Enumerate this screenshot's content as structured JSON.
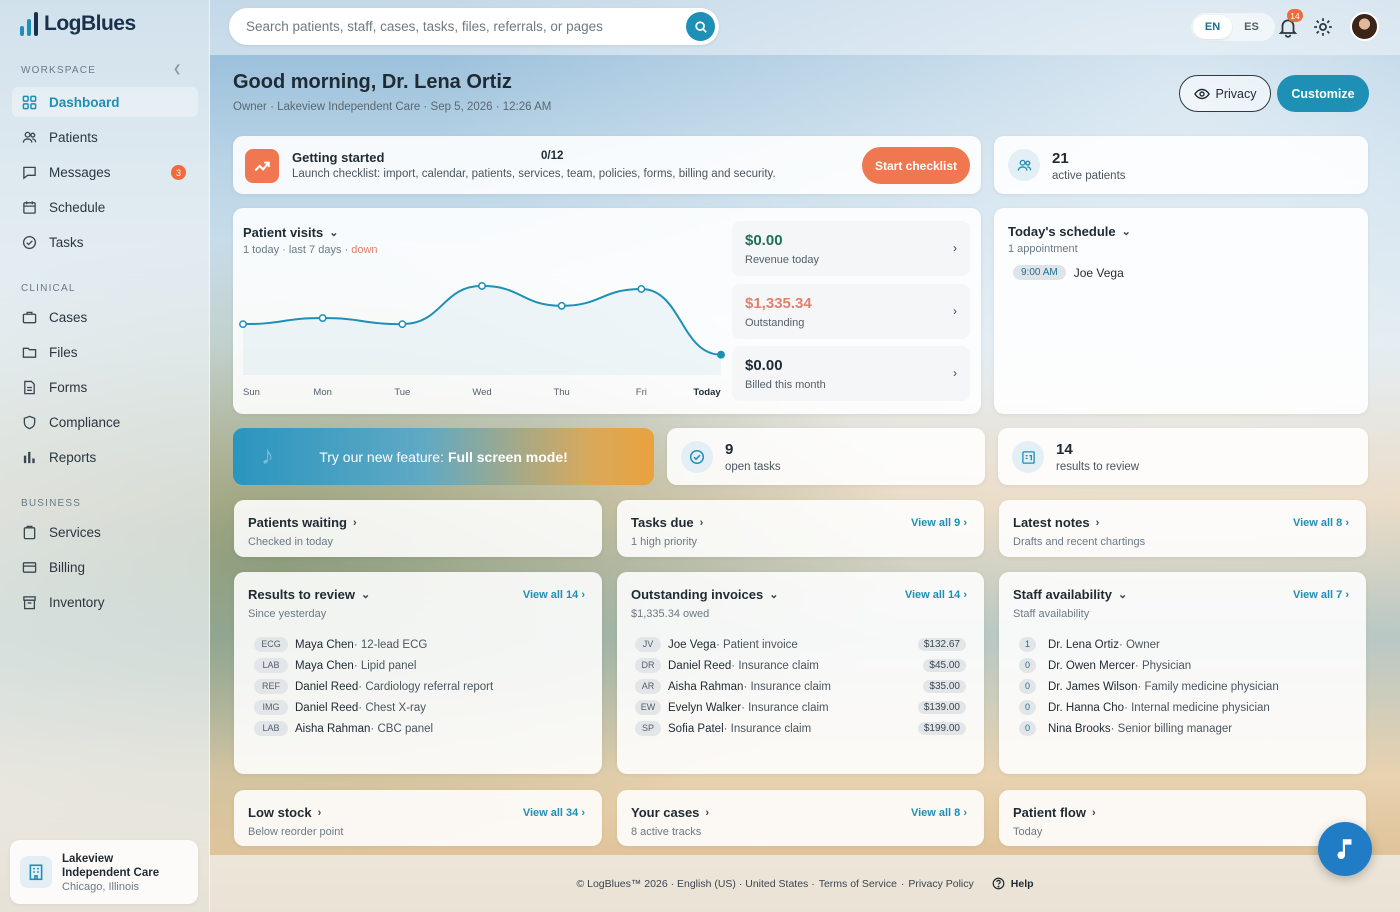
{
  "app": {
    "name": "LogBlues"
  },
  "search": {
    "placeholder": "Search patients, staff, cases, tasks, files, referrals, or pages"
  },
  "topbar": {
    "lang_en": "EN",
    "lang_es": "ES",
    "notifications_count": "14"
  },
  "sidebar": {
    "sections": [
      "WORKSPACE",
      "CLINICAL",
      "BUSINESS"
    ],
    "items": [
      {
        "label": "Dashboard",
        "icon": "grid-icon"
      },
      {
        "label": "Patients",
        "icon": "users-icon"
      },
      {
        "label": "Messages",
        "icon": "chat-icon",
        "badge": "3"
      },
      {
        "label": "Schedule",
        "icon": "calendar-icon"
      },
      {
        "label": "Tasks",
        "icon": "check-circle-icon"
      },
      {
        "label": "Cases",
        "icon": "briefcase-icon"
      },
      {
        "label": "Files",
        "icon": "folder-icon"
      },
      {
        "label": "Forms",
        "icon": "form-icon"
      },
      {
        "label": "Compliance",
        "icon": "shield-icon"
      },
      {
        "label": "Reports",
        "icon": "bar-chart-icon"
      },
      {
        "label": "Services",
        "icon": "clipboard-icon"
      },
      {
        "label": "Billing",
        "icon": "card-icon"
      },
      {
        "label": "Inventory",
        "icon": "box-icon"
      }
    ],
    "org": {
      "name_line1": "Lakeview",
      "name_line2": "Independent Care",
      "location": "Chicago, Illinois"
    }
  },
  "header": {
    "greeting": "Good morning, Dr. Lena Ortiz",
    "subline": "Owner · Lakeview Independent Care · Sep 5, 2026 · 12:26 AM",
    "privacy_label": "Privacy",
    "customize_label": "Customize"
  },
  "getting_started": {
    "title": "Getting started",
    "count": "0/12",
    "description": "Launch checklist: import, calendar, patients, services, team, policies, forms, billing and security.",
    "button": "Start checklist"
  },
  "active_patients": {
    "value": "21",
    "label": "active patients"
  },
  "patient_visits": {
    "title": "Patient visits",
    "sub_prefix": "1 today · last 7 days · ",
    "sub_trend": "down"
  },
  "chart_data": {
    "type": "line",
    "title": "Patient visits",
    "categories": [
      "Sun",
      "Mon",
      "Tue",
      "Wed",
      "Thu",
      "Fri",
      "Today"
    ],
    "series": [
      {
        "values": [
          3,
          3.4,
          3,
          5.5,
          4.2,
          5.3,
          1
        ]
      }
    ],
    "ylim": [
      0,
      7
    ],
    "grid": false
  },
  "financials": [
    {
      "value": "$0.00",
      "label": "Revenue today",
      "color": "#1f6f5a"
    },
    {
      "value": "$1,335.34",
      "label": "Outstanding",
      "color": "#e0826a"
    },
    {
      "value": "$0.00",
      "label": "Billed this month",
      "color": "#1f2a33"
    }
  ],
  "schedule": {
    "title": "Today's schedule",
    "sub": "1 appointment",
    "items": [
      {
        "time": "9:00 AM",
        "name": "Joe Vega"
      }
    ]
  },
  "promo": {
    "text": "Try our new feature: ",
    "bold": "Full screen mode!"
  },
  "open_tasks": {
    "value": "9",
    "label": "open tasks"
  },
  "results_to_review": {
    "value": "14",
    "label": "results to review"
  },
  "patients_waiting": {
    "title": "Patients waiting",
    "sub": "Checked in today"
  },
  "tasks_due": {
    "title": "Tasks due",
    "sub": "1 high priority",
    "view_all": "View all 9"
  },
  "latest_notes": {
    "title": "Latest notes",
    "sub": "Drafts and recent chartings",
    "view_all": "View all 8"
  },
  "results": {
    "title": "Results to review",
    "sub": "Since yesterday",
    "view_all": "View all 14",
    "rows": [
      {
        "tag": "ECG",
        "name": "Maya Chen",
        "detail": " · 12-lead ECG"
      },
      {
        "tag": "LAB",
        "name": "Maya Chen",
        "detail": " · Lipid panel"
      },
      {
        "tag": "REF",
        "name": "Daniel Reed",
        "detail": " · Cardiology referral report"
      },
      {
        "tag": "IMG",
        "name": "Daniel Reed",
        "detail": " · Chest X-ray"
      },
      {
        "tag": "LAB",
        "name": "Aisha Rahman",
        "detail": " · CBC panel"
      }
    ]
  },
  "invoices": {
    "title": "Outstanding invoices",
    "sub": "$1,335.34 owed",
    "view_all": "View all 14",
    "rows": [
      {
        "tag": "JV",
        "name": "Joe Vega",
        "detail": " · Patient invoice",
        "amount": "$132.67"
      },
      {
        "tag": "DR",
        "name": "Daniel Reed",
        "detail": " · Insurance claim",
        "amount": "$45.00"
      },
      {
        "tag": "AR",
        "name": "Aisha Rahman",
        "detail": " · Insurance claim",
        "amount": "$35.00"
      },
      {
        "tag": "EW",
        "name": "Evelyn Walker",
        "detail": " · Insurance claim",
        "amount": "$139.00"
      },
      {
        "tag": "SP",
        "name": "Sofia Patel",
        "detail": " · Insurance claim",
        "amount": "$199.00"
      }
    ]
  },
  "staff": {
    "title": "Staff availability",
    "sub": "Staff availability",
    "view_all": "View all 7",
    "rows": [
      {
        "num": "1",
        "name": "Dr. Lena Ortiz",
        "detail": " · Owner"
      },
      {
        "num": "0",
        "name": "Dr. Owen Mercer",
        "detail": " · Physician"
      },
      {
        "num": "0",
        "name": "Dr. James Wilson",
        "detail": " · Family medicine physician"
      },
      {
        "num": "0",
        "name": "Dr. Hanna Cho",
        "detail": " · Internal medicine physician"
      },
      {
        "num": "0",
        "name": "Nina Brooks",
        "detail": " · Senior billing manager"
      }
    ]
  },
  "low_stock": {
    "title": "Low stock",
    "sub": "Below reorder point",
    "view_all": "View all 34"
  },
  "your_cases": {
    "title": "Your cases",
    "sub": "8 active tracks",
    "view_all": "View all 8"
  },
  "patient_flow": {
    "title": "Patient flow",
    "sub": "Today"
  },
  "footer": {
    "copyright": "© LogBlues™ 2026 · English (US) · United States · ",
    "terms": "Terms of Service",
    "sep": " · ",
    "privacy": "Privacy Policy",
    "help": "Help"
  }
}
